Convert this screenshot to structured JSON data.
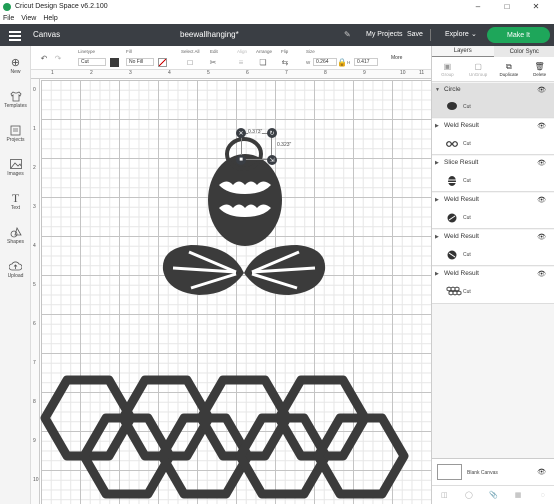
{
  "app": {
    "window_title": "Cricut Design Space  v6.2.100",
    "menu": [
      "File",
      "View",
      "Help"
    ]
  },
  "header": {
    "section": "Canvas",
    "project_name": "beewallhanging*",
    "my_projects": "My Projects",
    "save": "Save",
    "explore": "Explore",
    "make_it": "Make It"
  },
  "sidebar": {
    "items": [
      {
        "label": "New",
        "icon": "plus-icon"
      },
      {
        "label": "Templates",
        "icon": "shirt-icon"
      },
      {
        "label": "Projects",
        "icon": "projects-icon"
      },
      {
        "label": "Images",
        "icon": "image-icon"
      },
      {
        "label": "Text",
        "icon": "text-icon"
      },
      {
        "label": "Shapes",
        "icon": "shapes-icon"
      },
      {
        "label": "Upload",
        "icon": "upload-icon"
      }
    ]
  },
  "toolbar": {
    "linetype_label": "Linetype",
    "linetype_value": "Cut",
    "fill_label": "Fill",
    "fill_value": "No Fill",
    "select_all": "Select All",
    "edit": "Edit",
    "align": "Align",
    "arrange": "Arrange",
    "flip": "Flip",
    "size_label": "Size",
    "size_w_label": "W",
    "size_w_value": "0.264",
    "size_h_label": "H",
    "size_h_value": "0.417",
    "more": "More"
  },
  "ruler": {
    "top": [
      "1",
      "2",
      "3",
      "4",
      "5",
      "6",
      "7",
      "8",
      "9",
      "10",
      "11"
    ],
    "left": [
      "0",
      "1",
      "2",
      "3",
      "4",
      "5",
      "6",
      "7",
      "8",
      "9",
      "10"
    ]
  },
  "selection": {
    "width_dim": "0.373\"",
    "height_dim": "0.323\""
  },
  "panel": {
    "tabs": [
      "Layers",
      "Color Sync"
    ],
    "actions": [
      "Group",
      "UnGroup",
      "Duplicate",
      "Delete"
    ],
    "layers": [
      {
        "title": "Circle",
        "op": "Cut",
        "thumb": "circle-icon"
      },
      {
        "title": "Weld Result",
        "op": "Cut",
        "thumb": "chain-icon"
      },
      {
        "title": "Slice Result",
        "op": "Cut",
        "thumb": "bee-body-icon"
      },
      {
        "title": "Weld Result",
        "op": "Cut",
        "thumb": "weld-shape-icon"
      },
      {
        "title": "Weld Result",
        "op": "Cut",
        "thumb": "weld-shape-icon"
      },
      {
        "title": "Weld Result",
        "op": "Cut",
        "thumb": "honeycomb-icon"
      }
    ],
    "blank_canvas": "Blank Canvas"
  },
  "colors": {
    "header_bg": "#3a3e44",
    "make_it": "#1ea65a",
    "shape_fill": "#3b3b3b"
  }
}
